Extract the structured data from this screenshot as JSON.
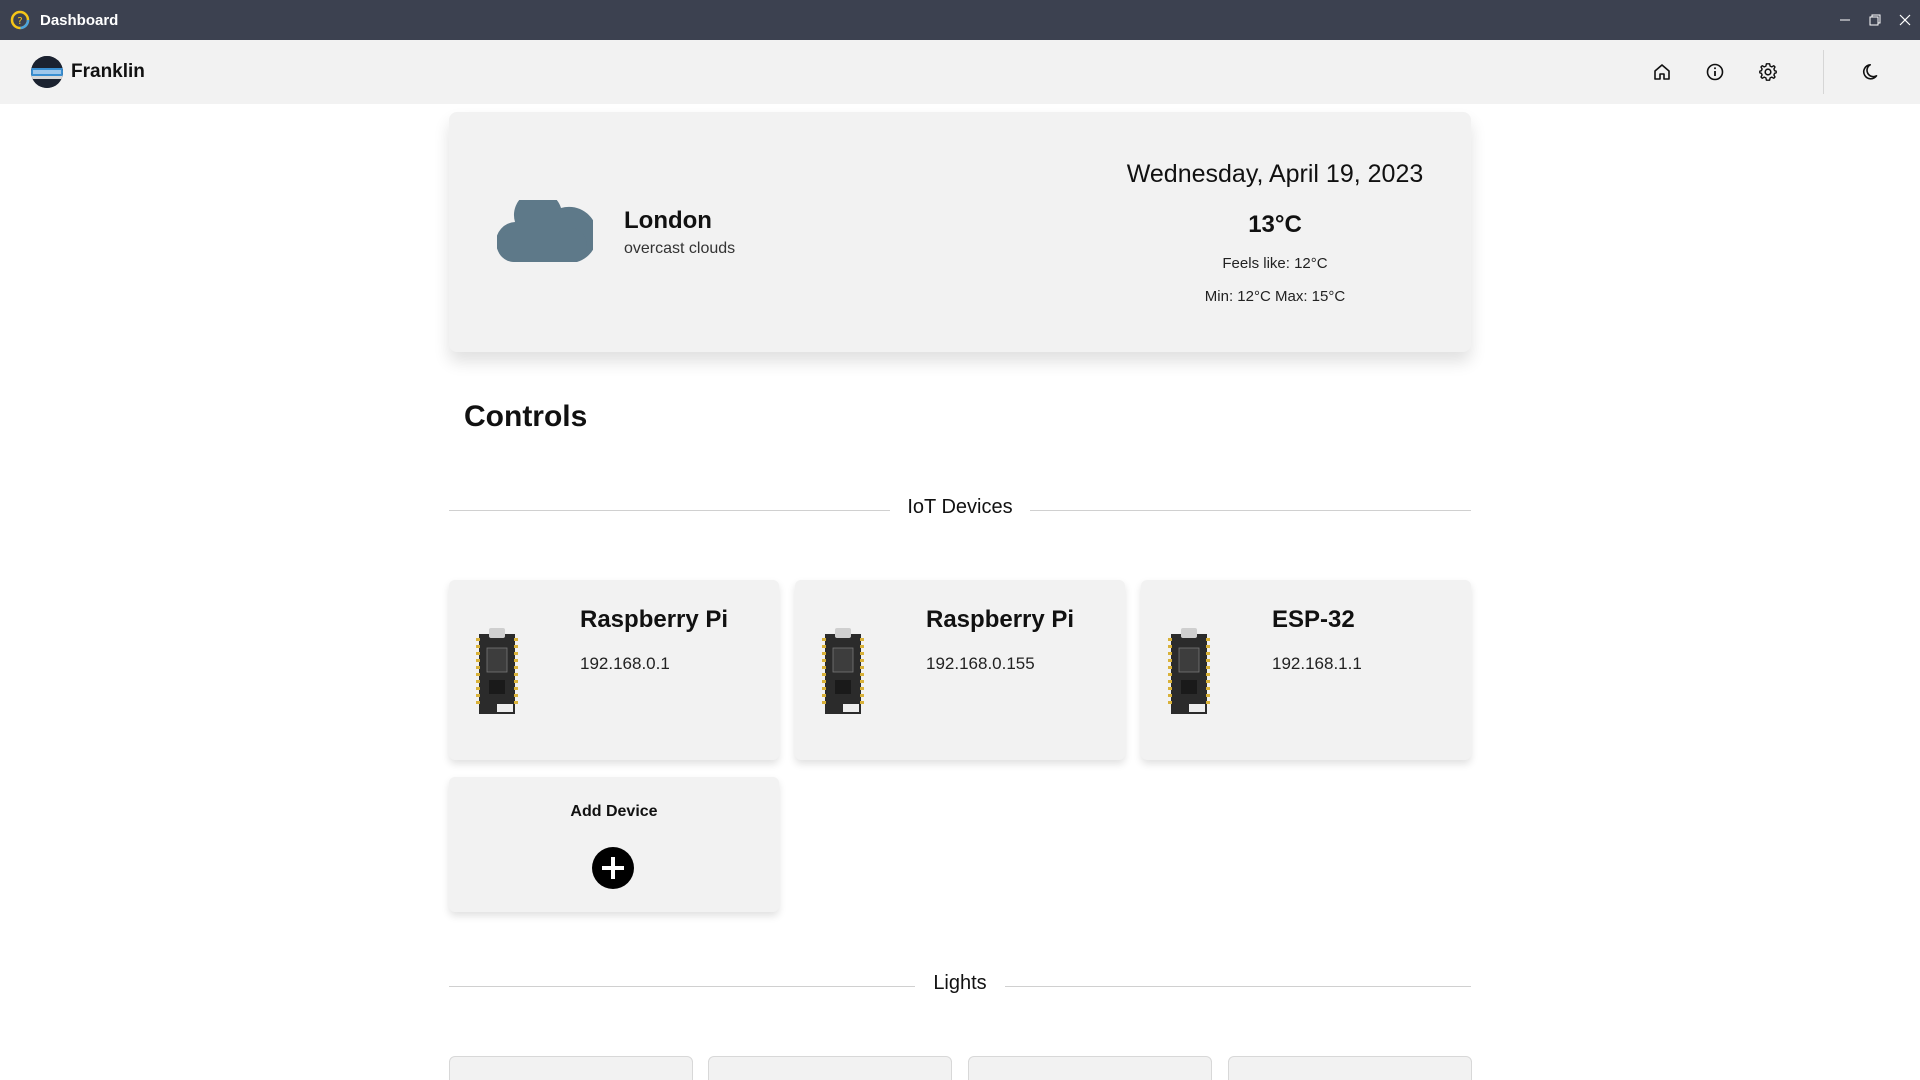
{
  "window": {
    "title": "Dashboard"
  },
  "header": {
    "brand": "Franklin"
  },
  "weather": {
    "city": "London",
    "description": "overcast clouds",
    "date": "Wednesday, April 19, 2023",
    "temperature": "13°C",
    "feels_like": "Feels like: 12°C",
    "min_max": "Min: 12°C Max: 15°C",
    "icon": "cloud-icon"
  },
  "controls": {
    "title": "Controls",
    "iot_section": "IoT Devices",
    "devices": [
      {
        "name": "Raspberry Pi",
        "ip": "192.168.0.1"
      },
      {
        "name": "Raspberry Pi",
        "ip": "192.168.0.155"
      },
      {
        "name": "ESP-32",
        "ip": "192.168.1.1"
      }
    ],
    "add_device": "Add Device",
    "lights_section": "Lights"
  },
  "colors": {
    "titlebar": "#3c4150",
    "header": "#f2f2f2",
    "card": "#f2f2f2",
    "cloud": "#5e7989"
  }
}
